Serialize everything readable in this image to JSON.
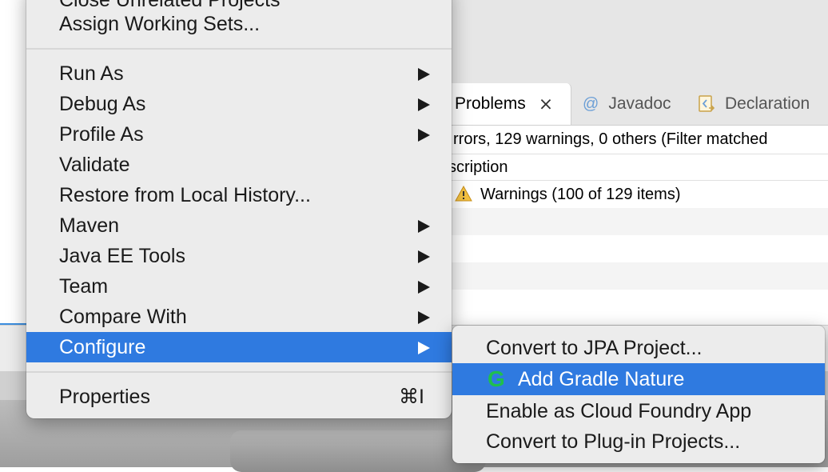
{
  "views": {
    "tabs": [
      {
        "label": "Problems",
        "active": true,
        "icon": "close-icon"
      },
      {
        "label": "Javadoc",
        "icon": "at-icon"
      },
      {
        "label": "Declaration",
        "icon": "declaration-icon"
      }
    ],
    "summary": "rrors, 129 warnings, 0 others (Filter matched",
    "column_header": "scription",
    "rows": [
      {
        "icon": "warning-icon",
        "text": "Warnings (100 of 129 items)"
      }
    ]
  },
  "menu": {
    "top_items": [
      {
        "label": "Close Unrelated Projects"
      },
      {
        "label": "Assign Working Sets..."
      }
    ],
    "items": [
      {
        "label": "Run As",
        "submenu": true
      },
      {
        "label": "Debug As",
        "submenu": true
      },
      {
        "label": "Profile As",
        "submenu": true
      },
      {
        "label": "Validate",
        "submenu": false
      },
      {
        "label": "Restore from Local History...",
        "submenu": false
      },
      {
        "label": "Maven",
        "submenu": true
      },
      {
        "label": "Java EE Tools",
        "submenu": true
      },
      {
        "label": "Team",
        "submenu": true
      },
      {
        "label": "Compare With",
        "submenu": true
      },
      {
        "label": "Configure",
        "submenu": true,
        "selected": true
      }
    ],
    "properties": {
      "label": "Properties",
      "shortcut": "⌘I"
    }
  },
  "submenu": {
    "items": [
      {
        "label": "Convert to JPA Project..."
      },
      {
        "label": "Add Gradle Nature",
        "icon": "gradle-icon",
        "icon_glyph": "G",
        "selected": true
      },
      {
        "label": "Enable as Cloud Foundry App"
      },
      {
        "label": "Convert to Plug-in Projects..."
      }
    ]
  },
  "colors": {
    "selection": "#2f7ae0",
    "menu_bg": "#ececec",
    "gradle_green": "#1fbf4d"
  }
}
